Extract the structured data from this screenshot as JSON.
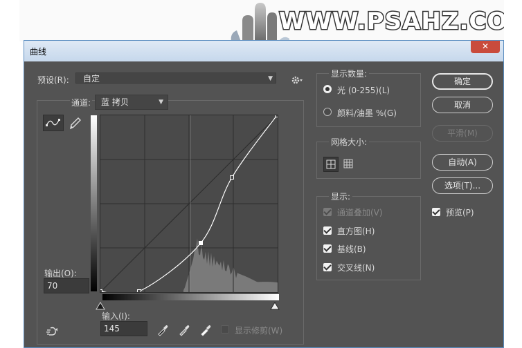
{
  "background": {
    "watermark": "WWW.PSAHZ.COM"
  },
  "dialog": {
    "title": "曲线",
    "close_label": "✕"
  },
  "preset": {
    "label": "预设(R):",
    "value": "自定"
  },
  "channel": {
    "label": "通道:",
    "value": "蓝 拷贝"
  },
  "output": {
    "label": "输出(O):",
    "value": "70"
  },
  "input": {
    "label": "输入(I):",
    "value": "145"
  },
  "show_clipping": {
    "label": "显示修剪(W)",
    "checked": false
  },
  "show_amount": {
    "title": "显示数量:",
    "options": [
      {
        "label": "光 (0-255)(L)",
        "selected": true
      },
      {
        "label": "颜料/油墨 %(G)",
        "selected": false
      }
    ]
  },
  "grid_size": {
    "title": "网格大小:"
  },
  "show": {
    "title": "显示:",
    "options": [
      {
        "label": "通道叠加(V)",
        "checked": true,
        "enabled": false
      },
      {
        "label": "直方图(H)",
        "checked": true,
        "enabled": true
      },
      {
        "label": "基线(B)",
        "checked": true,
        "enabled": true
      },
      {
        "label": "交叉线(N)",
        "checked": true,
        "enabled": true
      }
    ]
  },
  "buttons": {
    "ok": "确定",
    "cancel": "取消",
    "smooth": "平滑(M)",
    "auto": "自动(A)",
    "options": "选项(T)..."
  },
  "preview": {
    "label": "预览(P)",
    "checked": true
  },
  "curve": {
    "points": [
      [
        0,
        0
      ],
      [
        56,
        0
      ],
      [
        145,
        70
      ],
      [
        190,
        165
      ],
      [
        255,
        255
      ]
    ],
    "selected_point": [
      145,
      70
    ]
  },
  "colors": {
    "accent": "#5a8dc0",
    "panel": "#535353",
    "close": "#c94b3c"
  }
}
